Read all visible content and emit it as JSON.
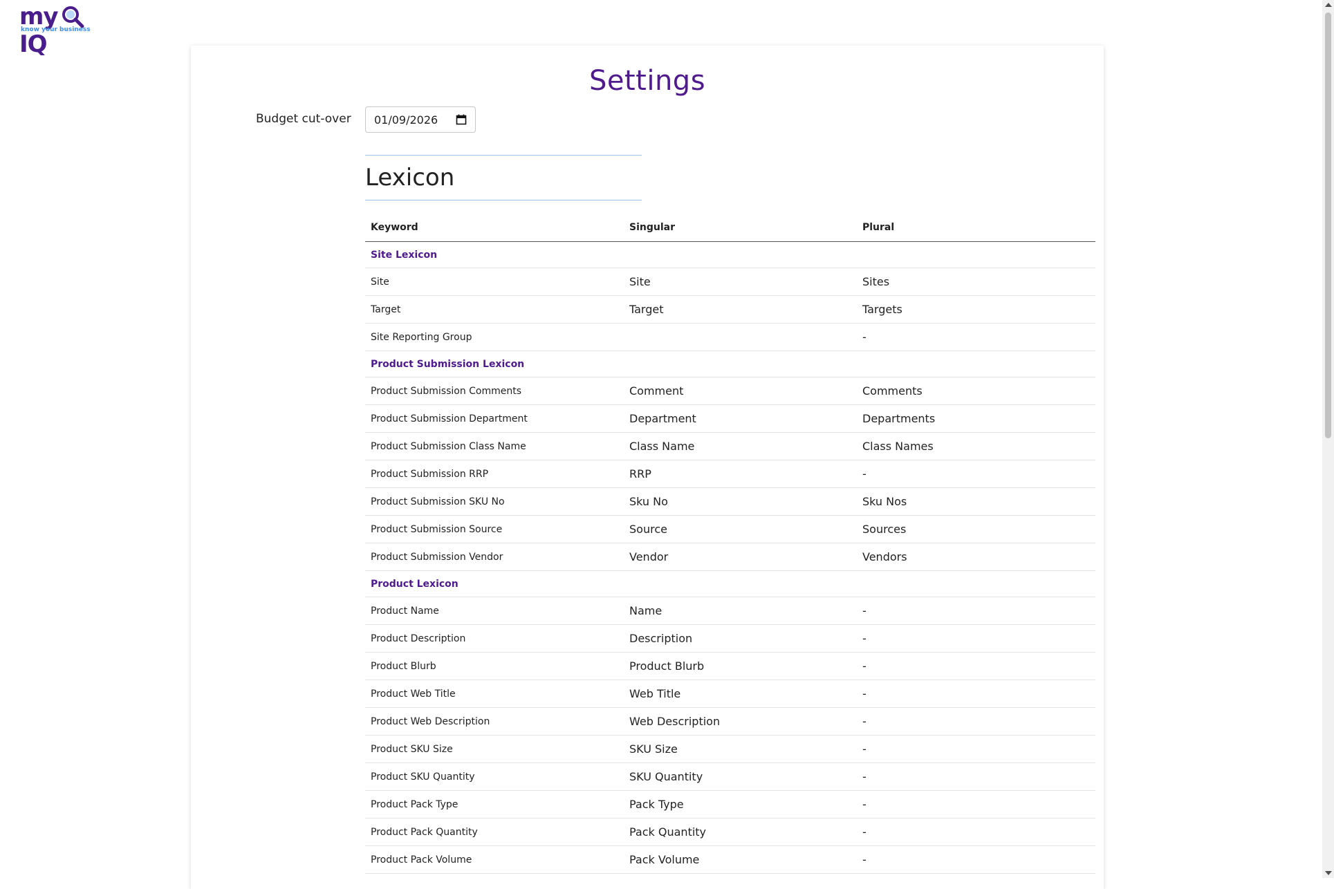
{
  "brand": {
    "logo_text": "my IQ",
    "tagline": "know your business",
    "colors": {
      "primary": "#4e1a8e",
      "tagline": "#3b8fe8"
    }
  },
  "page": {
    "title": "Settings"
  },
  "budget": {
    "label": "Budget cut-over",
    "value": "01/09/2026"
  },
  "lexicon": {
    "title": "Lexicon",
    "columns": {
      "keyword": "Keyword",
      "singular": "Singular",
      "plural": "Plural"
    },
    "sections": [
      {
        "name": "Site Lexicon",
        "rows": [
          {
            "keyword": "Site",
            "singular": "Site",
            "plural": "Sites"
          },
          {
            "keyword": "Target",
            "singular": "Target",
            "plural": "Targets"
          },
          {
            "keyword": "Site Reporting Group",
            "singular": "",
            "plural": "-"
          }
        ]
      },
      {
        "name": "Product Submission Lexicon",
        "rows": [
          {
            "keyword": "Product Submission Comments",
            "singular": "Comment",
            "plural": "Comments"
          },
          {
            "keyword": "Product Submission Department",
            "singular": "Department",
            "plural": "Departments"
          },
          {
            "keyword": "Product Submission Class Name",
            "singular": "Class Name",
            "plural": "Class Names"
          },
          {
            "keyword": "Product Submission RRP",
            "singular": "RRP",
            "plural": "-"
          },
          {
            "keyword": "Product Submission SKU No",
            "singular": "Sku No",
            "plural": "Sku Nos"
          },
          {
            "keyword": "Product Submission Source",
            "singular": "Source",
            "plural": "Sources"
          },
          {
            "keyword": "Product Submission Vendor",
            "singular": "Vendor",
            "plural": "Vendors"
          }
        ]
      },
      {
        "name": "Product Lexicon",
        "rows": [
          {
            "keyword": "Product Name",
            "singular": "Name",
            "plural": "-"
          },
          {
            "keyword": "Product Description",
            "singular": "Description",
            "plural": "-"
          },
          {
            "keyword": "Product Blurb",
            "singular": "Product Blurb",
            "plural": "-"
          },
          {
            "keyword": "Product Web Title",
            "singular": "Web Title",
            "plural": "-"
          },
          {
            "keyword": "Product Web Description",
            "singular": "Web Description",
            "plural": "-"
          },
          {
            "keyword": "Product SKU Size",
            "singular": "SKU Size",
            "plural": "-"
          },
          {
            "keyword": "Product SKU Quantity",
            "singular": "SKU Quantity",
            "plural": "-"
          },
          {
            "keyword": "Product Pack Type",
            "singular": "Pack Type",
            "plural": "-"
          },
          {
            "keyword": "Product Pack Quantity",
            "singular": "Pack Quantity",
            "plural": "-"
          },
          {
            "keyword": "Product Pack Volume",
            "singular": "Pack Volume",
            "plural": "-"
          }
        ]
      }
    ]
  }
}
